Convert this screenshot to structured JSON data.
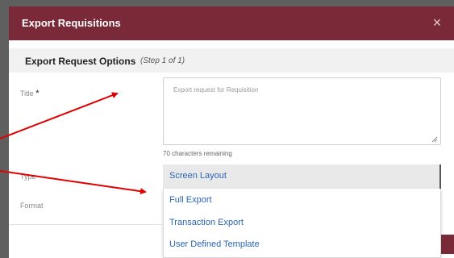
{
  "dialog": {
    "title": "Export Requisitions",
    "close_symbol": "×"
  },
  "section": {
    "heading": "Export Request Options",
    "step": "(Step 1 of 1)"
  },
  "title_field": {
    "label": "Title",
    "required_mark": "*",
    "placeholder": "Export request for Requisition",
    "remaining": "70 characters remaining"
  },
  "type_field": {
    "label": "Type",
    "selected": "Screen Layout",
    "options": [
      "Full Export",
      "Transaction Export",
      "User Defined Template"
    ]
  },
  "format_field": {
    "label": "Format"
  },
  "colors": {
    "header": "#7a2938",
    "link": "#2a66b3",
    "arrow": "#e00000"
  },
  "icons": [
    "close-icon",
    "resize-grip-icon"
  ]
}
